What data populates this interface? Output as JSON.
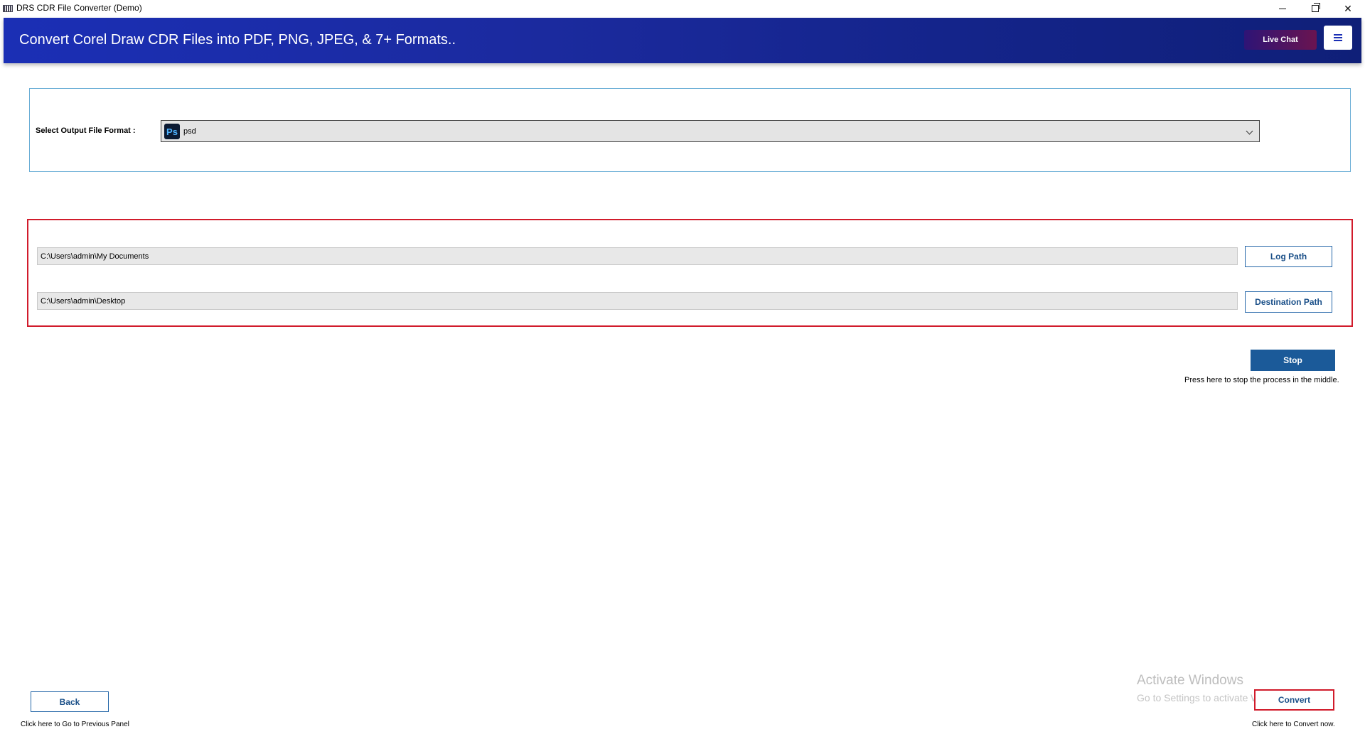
{
  "window": {
    "title": "DRS CDR File Converter (Demo)",
    "controls": [
      "minimize",
      "restore",
      "close"
    ]
  },
  "header": {
    "title": "Convert Corel Draw CDR Files into PDF, PNG, JPEG, & 7+ Formats..",
    "live_chat_label": "Live Chat",
    "menu_icon": "hamburger-icon",
    "colors": {
      "banner": "#1b2a9e",
      "live_chat": "#4a1466"
    }
  },
  "format": {
    "label": "Select Output File Format :",
    "selected_value": "psd",
    "selected_icon": "Ps"
  },
  "paths": {
    "log_path_value": "C:\\Users\\admin\\My Documents",
    "log_path_button": "Log Path",
    "destination_path_value": "C:\\Users\\admin\\Desktop",
    "destination_path_button": "Destination Path"
  },
  "stop": {
    "label": "Stop",
    "hint": "Press here to stop the process in the middle."
  },
  "footer": {
    "back_label": "Back",
    "back_hint": "Click here to Go to Previous Panel",
    "convert_label": "Convert",
    "convert_hint": "Click here to Convert now."
  },
  "watermark": {
    "title": "Activate Windows",
    "subtitle": "Go to Settings to activate Windows."
  }
}
